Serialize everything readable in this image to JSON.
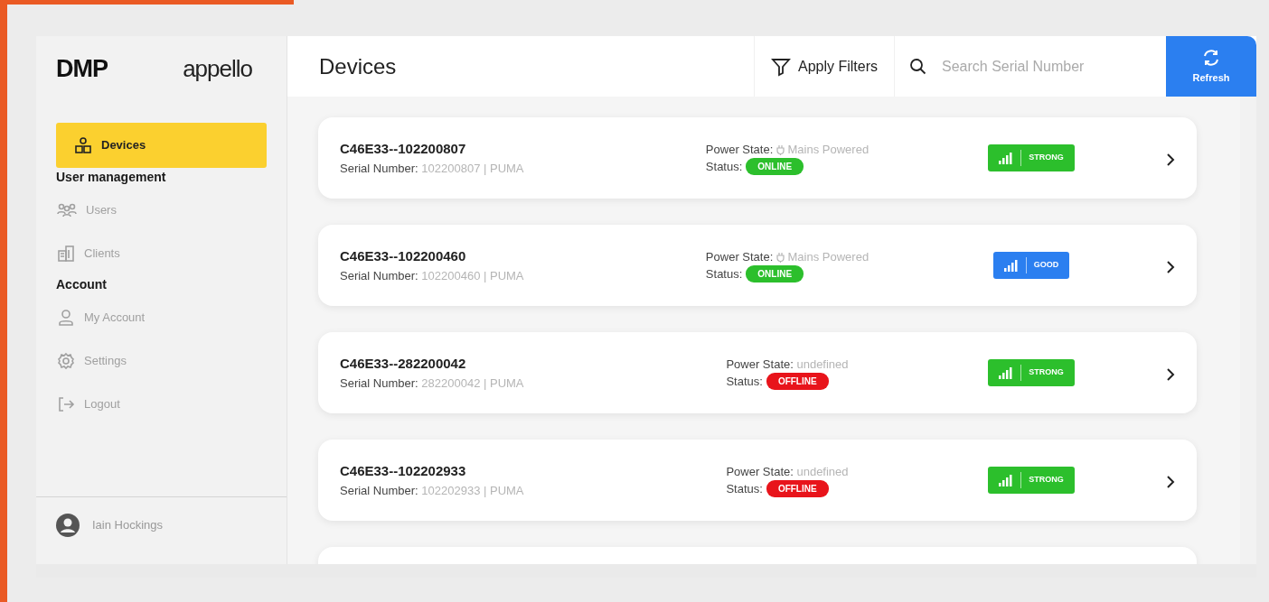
{
  "sidebar": {
    "logos": [
      "DMP",
      "appello"
    ],
    "items": [
      {
        "kind": "item",
        "label": "Devices",
        "selected": true
      },
      {
        "kind": "heading",
        "label": "User management"
      },
      {
        "kind": "item",
        "label": "Users",
        "selected": false
      },
      {
        "kind": "item",
        "label": "Clients",
        "selected": false
      },
      {
        "kind": "heading",
        "label": "Account"
      },
      {
        "kind": "item",
        "label": "My Account",
        "selected": false
      },
      {
        "kind": "item",
        "label": "Settings",
        "selected": false
      },
      {
        "kind": "item",
        "label": "Logout",
        "selected": false
      }
    ],
    "user": {
      "name": "Iain Hockings"
    }
  },
  "header": {
    "title": "Devices",
    "filter_button": "Apply Filters",
    "search": {
      "placeholder": "Search Serial Number"
    },
    "refresh_button": "Refresh"
  },
  "devices": [
    {
      "name": "C46E33--102200807",
      "serial_label": "Serial Number:",
      "serial": "102200807 | PUMA",
      "power_label": "Power State:",
      "power_icon": true,
      "power": "Mains Powered",
      "status_label": "Status:",
      "status": {
        "text": "ONLINE",
        "color": "#2cbf2c"
      },
      "signal": {
        "text": "STRONG",
        "color": "#2cbf2c"
      }
    },
    {
      "name": "C46E33--102200460",
      "serial_label": "Serial Number:",
      "serial": "102200460 | PUMA",
      "power_label": "Power State:",
      "power_icon": true,
      "power": "Mains Powered",
      "status_label": "Status:",
      "status": {
        "text": "ONLINE",
        "color": "#2cbf2c"
      },
      "signal": {
        "text": "GOOD",
        "color": "#2b7ff0"
      }
    },
    {
      "name": "C46E33--282200042",
      "serial_label": "Serial Number:",
      "serial": "282200042 | PUMA",
      "power_label": "Power State:",
      "power_icon": false,
      "power": "undefined",
      "status_label": "Status:",
      "status": {
        "text": "OFFLINE",
        "color": "#e8141b"
      },
      "signal": {
        "text": "STRONG",
        "color": "#2cbf2c"
      }
    },
    {
      "name": "C46E33--102202933",
      "serial_label": "Serial Number:",
      "serial": "102202933 | PUMA",
      "power_label": "Power State:",
      "power_icon": false,
      "power": "undefined",
      "status_label": "Status:",
      "status": {
        "text": "OFFLINE",
        "color": "#e8141b"
      },
      "signal": {
        "text": "STRONG",
        "color": "#2cbf2c"
      }
    }
  ]
}
